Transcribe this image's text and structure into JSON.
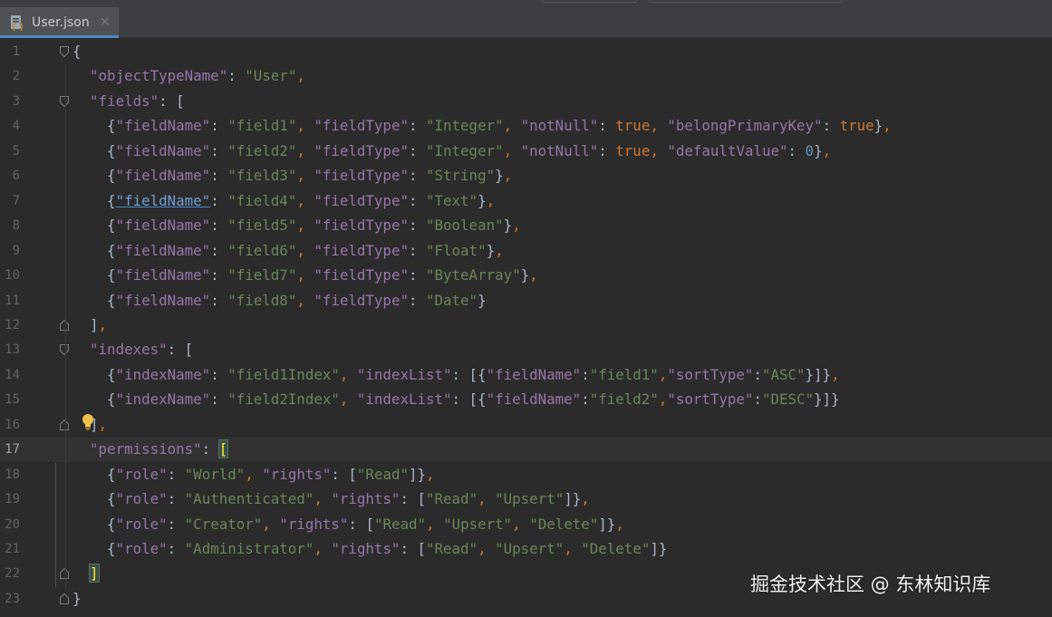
{
  "tab": {
    "label": "User.json",
    "close_glyph": "×",
    "icon": "json-file-icon"
  },
  "colors": {
    "background": "#2b2b2b",
    "tabbar": "#3c3f41",
    "key": "#9876aa",
    "string": "#6a8759",
    "keyword": "#cc7832",
    "number": "#6897bb",
    "punct": "#a9b7c6",
    "line_number": "#606366",
    "active_tab_underline": "#4a88c7",
    "bracket_match": "#ffef28"
  },
  "editor": {
    "current_line": 17,
    "lines": [
      {
        "n": "1",
        "fold": "open",
        "tokens": [
          [
            "p",
            "{"
          ]
        ]
      },
      {
        "n": "2",
        "fold": "",
        "tokens": [
          [
            "ws",
            "  "
          ],
          [
            "k",
            "\"objectTypeName\""
          ],
          [
            "c",
            ": "
          ],
          [
            "s",
            "\"User\""
          ],
          [
            "c",
            ","
          ]
        ]
      },
      {
        "n": "3",
        "fold": "open",
        "tokens": [
          [
            "ws",
            "  "
          ],
          [
            "k",
            "\"fields\""
          ],
          [
            "c",
            ": "
          ],
          [
            "p",
            "["
          ]
        ]
      },
      {
        "n": "4",
        "fold": "",
        "tokens": [
          [
            "ws",
            "    "
          ],
          [
            "p",
            "{"
          ],
          [
            "k",
            "\"fieldName\""
          ],
          [
            "c",
            ": "
          ],
          [
            "s",
            "\"field1\""
          ],
          [
            "c",
            ", "
          ],
          [
            "k",
            "\"fieldType\""
          ],
          [
            "c",
            ": "
          ],
          [
            "s",
            "\"Integer\""
          ],
          [
            "c",
            ", "
          ],
          [
            "k",
            "\"notNull\""
          ],
          [
            "c",
            ": "
          ],
          [
            "kw",
            "true"
          ],
          [
            "c",
            ", "
          ],
          [
            "k",
            "\"belongPrimaryKey\""
          ],
          [
            "c",
            ": "
          ],
          [
            "kw",
            "true"
          ],
          [
            "p",
            "}"
          ],
          [
            "c",
            ","
          ]
        ]
      },
      {
        "n": "5",
        "fold": "",
        "tokens": [
          [
            "ws",
            "    "
          ],
          [
            "p",
            "{"
          ],
          [
            "k",
            "\"fieldName\""
          ],
          [
            "c",
            ": "
          ],
          [
            "s",
            "\"field2\""
          ],
          [
            "c",
            ", "
          ],
          [
            "k",
            "\"fieldType\""
          ],
          [
            "c",
            ": "
          ],
          [
            "s",
            "\"Integer\""
          ],
          [
            "c",
            ", "
          ],
          [
            "k",
            "\"notNull\""
          ],
          [
            "c",
            ": "
          ],
          [
            "kw",
            "true"
          ],
          [
            "c",
            ", "
          ],
          [
            "k",
            "\"defaultValue\""
          ],
          [
            "c",
            ": "
          ],
          [
            "n",
            "0"
          ],
          [
            "p",
            "}"
          ],
          [
            "c",
            ","
          ]
        ]
      },
      {
        "n": "6",
        "fold": "",
        "tokens": [
          [
            "ws",
            "    "
          ],
          [
            "p",
            "{"
          ],
          [
            "k",
            "\"fieldName\""
          ],
          [
            "c",
            ": "
          ],
          [
            "s",
            "\"field3\""
          ],
          [
            "c",
            ", "
          ],
          [
            "k",
            "\"fieldType\""
          ],
          [
            "c",
            ": "
          ],
          [
            "s",
            "\"String\""
          ],
          [
            "p",
            "}"
          ],
          [
            "c",
            ","
          ]
        ]
      },
      {
        "n": "7",
        "fold": "",
        "tokens": [
          [
            "ws",
            "    "
          ],
          [
            "p",
            "{"
          ],
          [
            "ku",
            "\"fieldName\""
          ],
          [
            "c",
            ": "
          ],
          [
            "s",
            "\"field4\""
          ],
          [
            "c",
            ", "
          ],
          [
            "k",
            "\"fieldType\""
          ],
          [
            "c",
            ": "
          ],
          [
            "s",
            "\"Text\""
          ],
          [
            "p",
            "}"
          ],
          [
            "c",
            ","
          ]
        ]
      },
      {
        "n": "8",
        "fold": "",
        "tokens": [
          [
            "ws",
            "    "
          ],
          [
            "p",
            "{"
          ],
          [
            "k",
            "\"fieldName\""
          ],
          [
            "c",
            ": "
          ],
          [
            "s",
            "\"field5\""
          ],
          [
            "c",
            ", "
          ],
          [
            "k",
            "\"fieldType\""
          ],
          [
            "c",
            ": "
          ],
          [
            "s",
            "\"Boolean\""
          ],
          [
            "p",
            "}"
          ],
          [
            "c",
            ","
          ]
        ]
      },
      {
        "n": "9",
        "fold": "",
        "tokens": [
          [
            "ws",
            "    "
          ],
          [
            "p",
            "{"
          ],
          [
            "k",
            "\"fieldName\""
          ],
          [
            "c",
            ": "
          ],
          [
            "s",
            "\"field6\""
          ],
          [
            "c",
            ", "
          ],
          [
            "k",
            "\"fieldType\""
          ],
          [
            "c",
            ": "
          ],
          [
            "s",
            "\"Float\""
          ],
          [
            "p",
            "}"
          ],
          [
            "c",
            ","
          ]
        ]
      },
      {
        "n": "10",
        "fold": "",
        "tokens": [
          [
            "ws",
            "    "
          ],
          [
            "p",
            "{"
          ],
          [
            "k",
            "\"fieldName\""
          ],
          [
            "c",
            ": "
          ],
          [
            "s",
            "\"field7\""
          ],
          [
            "c",
            ", "
          ],
          [
            "k",
            "\"fieldType\""
          ],
          [
            "c",
            ": "
          ],
          [
            "s",
            "\"ByteArray\""
          ],
          [
            "p",
            "}"
          ],
          [
            "c",
            ","
          ]
        ]
      },
      {
        "n": "11",
        "fold": "",
        "tokens": [
          [
            "ws",
            "    "
          ],
          [
            "p",
            "{"
          ],
          [
            "k",
            "\"fieldName\""
          ],
          [
            "c",
            ": "
          ],
          [
            "s",
            "\"field8\""
          ],
          [
            "c",
            ", "
          ],
          [
            "k",
            "\"fieldType\""
          ],
          [
            "c",
            ": "
          ],
          [
            "s",
            "\"Date\""
          ],
          [
            "p",
            "}"
          ]
        ]
      },
      {
        "n": "12",
        "fold": "close",
        "tokens": [
          [
            "ws",
            "  "
          ],
          [
            "p",
            "]"
          ],
          [
            "c",
            ","
          ]
        ]
      },
      {
        "n": "13",
        "fold": "open",
        "tokens": [
          [
            "ws",
            "  "
          ],
          [
            "k",
            "\"indexes\""
          ],
          [
            "c",
            ": "
          ],
          [
            "p",
            "["
          ]
        ]
      },
      {
        "n": "14",
        "fold": "",
        "tokens": [
          [
            "ws",
            "    "
          ],
          [
            "p",
            "{"
          ],
          [
            "k",
            "\"indexName\""
          ],
          [
            "c",
            ": "
          ],
          [
            "s",
            "\"field1Index\""
          ],
          [
            "c",
            ", "
          ],
          [
            "k",
            "\"indexList\""
          ],
          [
            "c",
            ": "
          ],
          [
            "p",
            "[{"
          ],
          [
            "k",
            "\"fieldName\""
          ],
          [
            "c",
            ":"
          ],
          [
            "s",
            "\"field1\""
          ],
          [
            "c",
            ","
          ],
          [
            "k",
            "\"sortType\""
          ],
          [
            "c",
            ":"
          ],
          [
            "s",
            "\"ASC\""
          ],
          [
            "p",
            "}]}"
          ],
          [
            "c",
            ","
          ]
        ]
      },
      {
        "n": "15",
        "fold": "",
        "tokens": [
          [
            "ws",
            "    "
          ],
          [
            "p",
            "{"
          ],
          [
            "k",
            "\"indexName\""
          ],
          [
            "c",
            ": "
          ],
          [
            "s",
            "\"field2Index\""
          ],
          [
            "c",
            ", "
          ],
          [
            "k",
            "\"indexList\""
          ],
          [
            "c",
            ": "
          ],
          [
            "p",
            "[{"
          ],
          [
            "k",
            "\"fieldName\""
          ],
          [
            "c",
            ":"
          ],
          [
            "s",
            "\"field2\""
          ],
          [
            "c",
            ","
          ],
          [
            "k",
            "\"sortType\""
          ],
          [
            "c",
            ":"
          ],
          [
            "s",
            "\"DESC\""
          ],
          [
            "p",
            "}]}"
          ]
        ]
      },
      {
        "n": "16",
        "fold": "close",
        "tokens": [
          [
            "ws",
            "  "
          ],
          [
            "p",
            "]"
          ],
          [
            "c",
            ","
          ]
        ]
      },
      {
        "n": "17",
        "fold": "",
        "tokens": [
          [
            "ws",
            "  "
          ],
          [
            "k",
            "\"permissions\""
          ],
          [
            "c",
            ": "
          ],
          [
            "bm",
            "["
          ]
        ]
      },
      {
        "n": "18",
        "fold": "",
        "tokens": [
          [
            "ws",
            "    "
          ],
          [
            "p",
            "{"
          ],
          [
            "k",
            "\"role\""
          ],
          [
            "c",
            ": "
          ],
          [
            "s",
            "\"World\""
          ],
          [
            "c",
            ", "
          ],
          [
            "k",
            "\"rights\""
          ],
          [
            "c",
            ": "
          ],
          [
            "p",
            "["
          ],
          [
            "s",
            "\"Read\""
          ],
          [
            "p",
            "]}"
          ],
          [
            "c",
            ","
          ]
        ]
      },
      {
        "n": "19",
        "fold": "",
        "tokens": [
          [
            "ws",
            "    "
          ],
          [
            "p",
            "{"
          ],
          [
            "k",
            "\"role\""
          ],
          [
            "c",
            ": "
          ],
          [
            "s",
            "\"Authenticated\""
          ],
          [
            "c",
            ", "
          ],
          [
            "k",
            "\"rights\""
          ],
          [
            "c",
            ": "
          ],
          [
            "p",
            "["
          ],
          [
            "s",
            "\"Read\""
          ],
          [
            "c",
            ", "
          ],
          [
            "s",
            "\"Upsert\""
          ],
          [
            "p",
            "]}"
          ],
          [
            "c",
            ","
          ]
        ]
      },
      {
        "n": "20",
        "fold": "",
        "tokens": [
          [
            "ws",
            "    "
          ],
          [
            "p",
            "{"
          ],
          [
            "k",
            "\"role\""
          ],
          [
            "c",
            ": "
          ],
          [
            "s",
            "\"Creator\""
          ],
          [
            "c",
            ", "
          ],
          [
            "k",
            "\"rights\""
          ],
          [
            "c",
            ": "
          ],
          [
            "p",
            "["
          ],
          [
            "s",
            "\"Read\""
          ],
          [
            "c",
            ", "
          ],
          [
            "s",
            "\"Upsert\""
          ],
          [
            "c",
            ", "
          ],
          [
            "s",
            "\"Delete\""
          ],
          [
            "p",
            "]}"
          ],
          [
            "c",
            ","
          ]
        ]
      },
      {
        "n": "21",
        "fold": "",
        "tokens": [
          [
            "ws",
            "    "
          ],
          [
            "p",
            "{"
          ],
          [
            "k",
            "\"role\""
          ],
          [
            "c",
            ": "
          ],
          [
            "s",
            "\"Administrator\""
          ],
          [
            "c",
            ", "
          ],
          [
            "k",
            "\"rights\""
          ],
          [
            "c",
            ": "
          ],
          [
            "p",
            "["
          ],
          [
            "s",
            "\"Read\""
          ],
          [
            "c",
            ", "
          ],
          [
            "s",
            "\"Upsert\""
          ],
          [
            "c",
            ", "
          ],
          [
            "s",
            "\"Delete\""
          ],
          [
            "p",
            "]}"
          ]
        ]
      },
      {
        "n": "22",
        "fold": "close",
        "tokens": [
          [
            "ws",
            "  "
          ],
          [
            "bm",
            "]"
          ]
        ]
      },
      {
        "n": "23",
        "fold": "close",
        "tokens": [
          [
            "p",
            "}"
          ]
        ]
      }
    ]
  },
  "watermark": "掘金技术社区 @ 东林知识库"
}
